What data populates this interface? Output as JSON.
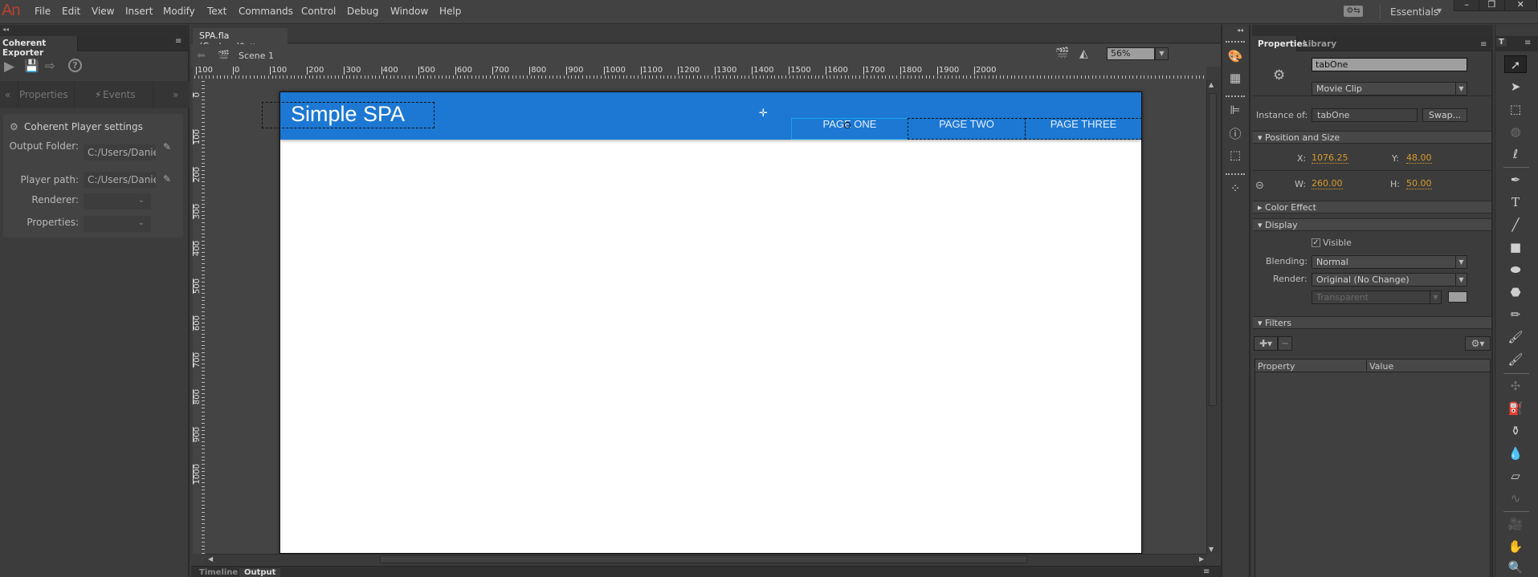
{
  "app": {
    "logo": "An"
  },
  "menubar": {
    "items": [
      "File",
      "Edit",
      "View",
      "Insert",
      "Modify",
      "Text",
      "Commands",
      "Control",
      "Debug",
      "Window",
      "Help"
    ],
    "workspace_label": "Essentials",
    "workspace_icon": "sync-settings-icon",
    "window_controls": [
      "–",
      "❐",
      "✕"
    ]
  },
  "left_panel": {
    "tab": "Coherent Exporter",
    "toolbar_icons": [
      "play-icon",
      "save-icon",
      "export-icon",
      "help-icon"
    ],
    "subtabs": {
      "prev": "«",
      "properties": "Properties",
      "events": "Events",
      "next": "»"
    },
    "section_title": "Coherent Player settings",
    "fields": [
      {
        "label": "Output Folder:",
        "value": "C:/Users/Daniel"
      },
      {
        "label": "Player path:",
        "value": "C:/Users/Daniel"
      },
      {
        "label": "Renderer:",
        "value": ""
      },
      {
        "label": "Properties:",
        "value": ""
      }
    ]
  },
  "document": {
    "tab_title": "SPA.fla (Custom)*",
    "scene": "Scene 1",
    "zoom": "56%",
    "ruler_h": [
      "100",
      "0",
      "100",
      "200",
      "300",
      "400",
      "500",
      "600",
      "700",
      "800",
      "900",
      "1000",
      "1100",
      "1200",
      "1300",
      "1400",
      "1500",
      "1600",
      "1700",
      "1800",
      "1900",
      "2000"
    ],
    "ruler_v": [
      "0",
      "100",
      "200",
      "300",
      "400",
      "500",
      "600",
      "700",
      "800",
      "900",
      "1000"
    ],
    "stage": {
      "header_color": "#1c78d3",
      "title": "Simple SPA",
      "tabs": [
        "PAGE ONE",
        "PAGE TWO",
        "PAGE THREE"
      ]
    },
    "bottom_tabs": [
      "Timeline",
      "Output"
    ]
  },
  "properties": {
    "tabs": [
      "Properties",
      "Library"
    ],
    "instance_name": "tabOne",
    "symbol_type": "Movie Clip",
    "instance_of_label": "Instance of:",
    "instance_of": "tabOne",
    "swap_label": "Swap...",
    "position_size": {
      "title": "Position and Size",
      "x_label": "X:",
      "x": "1076.25",
      "y_label": "Y:",
      "y": "48.00",
      "w_label": "W:",
      "w": "260.00",
      "h_label": "H:",
      "h": "50.00"
    },
    "color_effect": "Color Effect",
    "display": {
      "title": "Display",
      "visible_label": "Visible",
      "visible": true,
      "blending_label": "Blending:",
      "blending": "Normal",
      "render_label": "Render:",
      "render": "Original (No Change)",
      "bg_option": "Transparent"
    },
    "filters": {
      "title": "Filters",
      "columns": [
        "Property",
        "Value"
      ]
    }
  },
  "tools": {
    "header": "T",
    "items": [
      "selection",
      "subselection",
      "free-transform",
      "3d-rotation",
      "lasso",
      "pen",
      "text",
      "line",
      "rectangle",
      "oval",
      "polystar",
      "pencil",
      "paint-brush",
      "brush",
      "bone",
      "paint-bucket",
      "ink-bottle",
      "eyedropper",
      "eraser",
      "width",
      "camera",
      "hand",
      "zoom"
    ]
  }
}
